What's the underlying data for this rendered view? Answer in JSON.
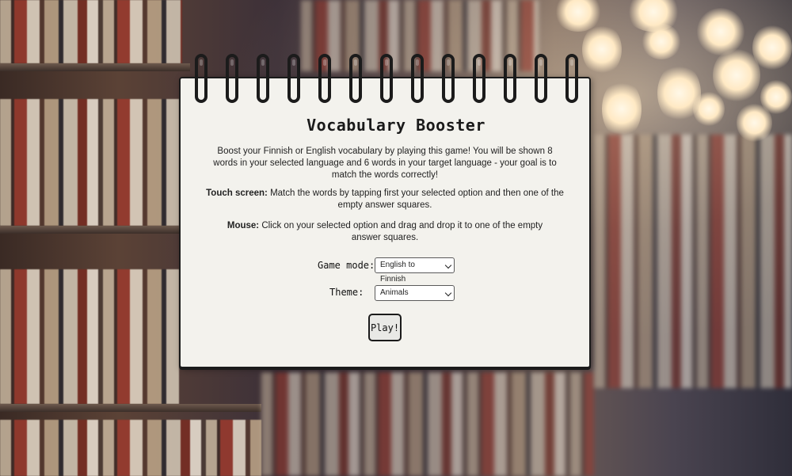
{
  "app": {
    "title": "Vocabulary Booster"
  },
  "intro": {
    "text": "Boost your Finnish or English vocabulary by playing this game! You will be shown 8 words in your selected language and 6 words in your target language - your goal is to match the words correctly!"
  },
  "touch": {
    "label": "Touch screen:",
    "text": "Match the words by tapping first your selected option and then one of the empty answer squares."
  },
  "mouse": {
    "label": "Mouse:",
    "text": "Click on your selected option and drag and drop it to one of the empty answer squares."
  },
  "form": {
    "game_mode_label": "Game mode:",
    "game_mode_value": "English to Finnish",
    "theme_label": "Theme:",
    "theme_value": "Animals",
    "play_label": "Play!"
  },
  "colors": {
    "card_bg": "#f3f2ed",
    "ink": "#1b1b1b"
  }
}
